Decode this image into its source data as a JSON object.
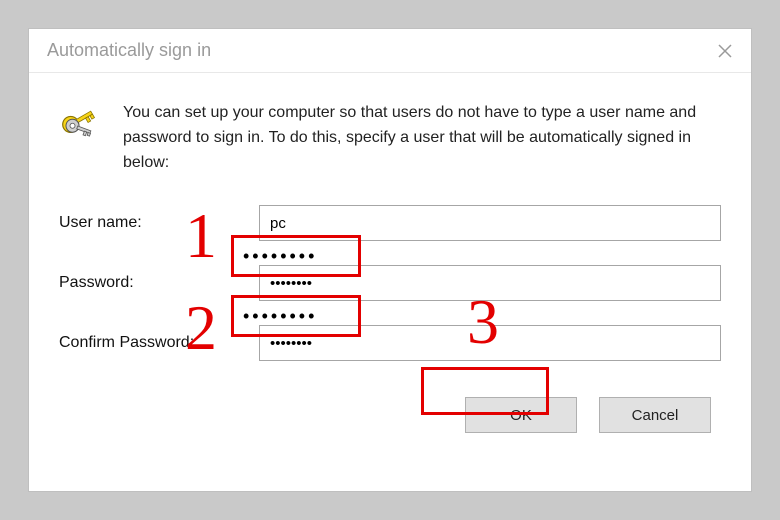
{
  "dialog": {
    "title": "Automatically sign in",
    "description": "You can set up your computer so that users do not have to type a user name and password to sign in. To do this, specify a user that will be automatically signed in below:"
  },
  "form": {
    "username_label": "User name:",
    "username_value": "pc",
    "password_label": "Password:",
    "password_value": "••••••••",
    "confirm_label": "Confirm Password:",
    "confirm_value": "••••••••"
  },
  "buttons": {
    "ok": "OK",
    "cancel": "Cancel"
  },
  "annotations": {
    "one": "1",
    "two": "2",
    "three": "3"
  }
}
